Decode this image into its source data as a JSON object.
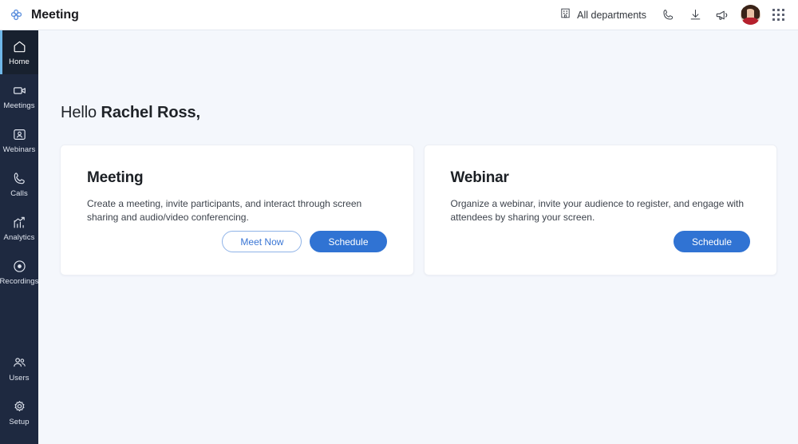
{
  "app": {
    "title": "Meeting",
    "logo_icon": "clover-logo-icon"
  },
  "colors": {
    "accent_blue": "#3073d3",
    "outline_blue": "#3a76d5",
    "sidebar_bg": "#1e2940",
    "sidebar_active_bg": "#18212f",
    "sidebar_active_accent": "#6fb7e8",
    "page_bg": "#f4f7fc",
    "card_bg": "#ffffff"
  },
  "topbar": {
    "department_label": "All departments",
    "department_icon": "building-icon",
    "actions": [
      {
        "name": "phone-icon",
        "label": "Calls"
      },
      {
        "name": "download-icon",
        "label": "Download"
      },
      {
        "name": "megaphone-icon",
        "label": "Announcements"
      }
    ],
    "avatar": {
      "name": "user-avatar",
      "label": "Rachel Ross"
    },
    "apps_icon": "apps-grid-icon"
  },
  "sidebar": {
    "top_items": [
      {
        "label": "Home",
        "icon": "home-icon",
        "active": true
      },
      {
        "label": "Meetings",
        "icon": "video-camera-icon",
        "active": false
      },
      {
        "label": "Webinars",
        "icon": "webinar-person-icon",
        "active": false
      },
      {
        "label": "Calls",
        "icon": "phone-icon",
        "active": false
      },
      {
        "label": "Analytics",
        "icon": "chart-up-icon",
        "active": false
      },
      {
        "label": "Recordings",
        "icon": "record-dot-icon",
        "active": false
      }
    ],
    "bottom_items": [
      {
        "label": "Users",
        "icon": "users-icon",
        "active": false
      },
      {
        "label": "Setup",
        "icon": "gear-icon",
        "active": false
      }
    ]
  },
  "main": {
    "greeting_prefix": "Hello ",
    "greeting_name": "Rachel Ross,",
    "cards": [
      {
        "title": "Meeting",
        "description": "Create a meeting, invite participants, and interact through screen sharing and audio/video conferencing.",
        "secondary_button": "Meet Now",
        "primary_button": "Schedule"
      },
      {
        "title": "Webinar",
        "description": "Organize a webinar, invite your audience to register, and engage with attendees by sharing your screen.",
        "primary_button": "Schedule"
      }
    ]
  }
}
